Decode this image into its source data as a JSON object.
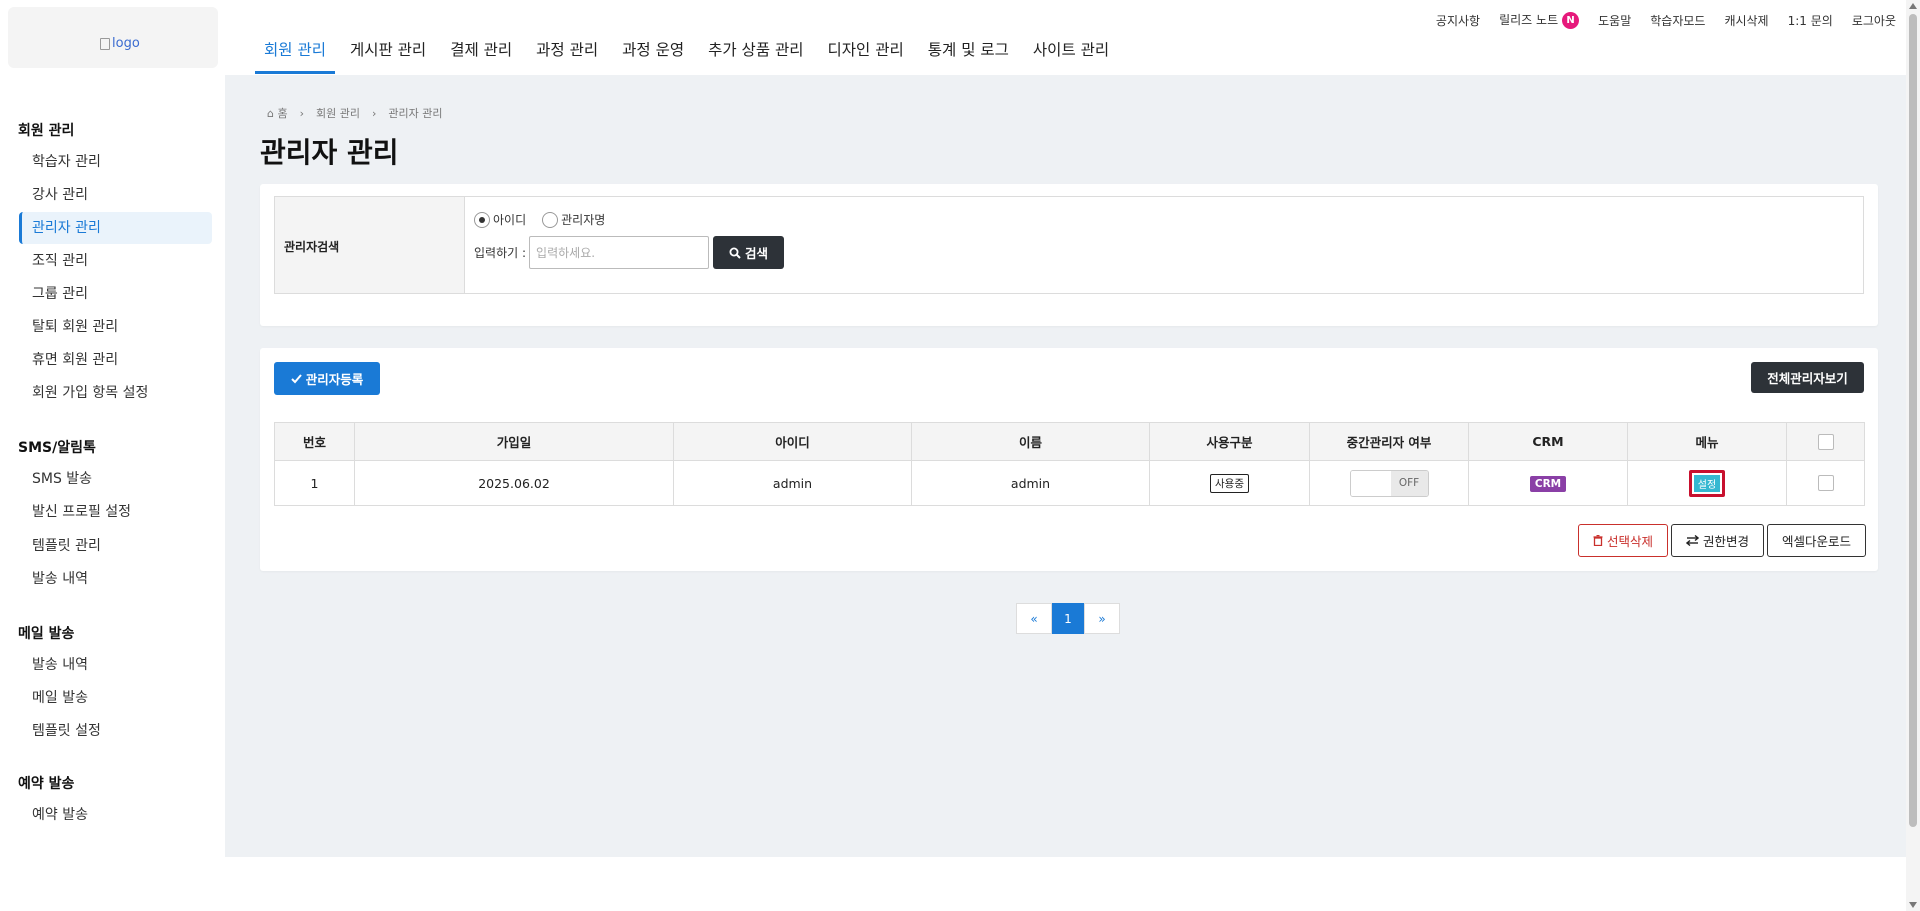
{
  "header": {
    "logo_alt": "logo",
    "gnb": [
      "회원 관리",
      "게시판 관리",
      "결제 관리",
      "과정 관리",
      "과정 운영",
      "추가 상품 관리",
      "디자인 관리",
      "통계 및 로그",
      "사이트 관리"
    ],
    "util": {
      "notice": "공지사항",
      "release_notes": "릴리즈 노트",
      "release_badge": "N",
      "help": "도움말",
      "learner_mode": "학습자모드",
      "cache_delete": "캐시삭제",
      "inquiry": "1:1 문의",
      "logout": "로그아웃"
    }
  },
  "sidebar": {
    "groups": [
      {
        "title": "회원 관리",
        "items": [
          "학습자 관리",
          "강사 관리",
          "관리자 관리",
          "조직 관리",
          "그룹 관리",
          "탈퇴 회원 관리",
          "휴면 회원 관리",
          "회원 가입 항목 설정"
        ]
      },
      {
        "title": "SMS/알림톡",
        "items": [
          "SMS 발송",
          "발신 프로필 설정",
          "템플릿 관리",
          "발송 내역"
        ]
      },
      {
        "title": "메일 발송",
        "items": [
          "발송 내역",
          "메일 발송",
          "템플릿 설정"
        ]
      },
      {
        "title": "예약 발송",
        "items": [
          "예약 발송"
        ]
      }
    ]
  },
  "breadcrumb": {
    "home": "홈",
    "level1": "회원 관리",
    "level2": "관리자 관리"
  },
  "page_title": "관리자 관리",
  "search": {
    "label": "관리자검색",
    "radio_id": "아이디",
    "radio_name": "관리자명",
    "input_label": "입력하기 :",
    "placeholder": "입력하세요.",
    "button": "검색"
  },
  "list": {
    "register_button": "관리자등록",
    "view_all_button": "전체관리자보기",
    "columns": [
      "번호",
      "가입일",
      "아이디",
      "이름",
      "사용구분",
      "중간관리자 여부",
      "CRM",
      "메뉴"
    ],
    "rows": [
      {
        "no": "1",
        "joined": "2025.06.02",
        "id": "admin",
        "name": "admin",
        "status": "사용중",
        "toggle": "OFF",
        "crm": "CRM",
        "menu": "설정"
      }
    ],
    "delete_button": "선택삭제",
    "permission_button": "권한변경",
    "excel_button": "엑셀다운로드"
  },
  "pager": {
    "prev": "«",
    "current": "1",
    "next": "»"
  },
  "colors": {
    "primary": "#1a7ad6",
    "dark": "#2d3238",
    "crm": "#8a3fa6",
    "setting": "#35b8d1",
    "highlight": "#c8102e",
    "badge": "#e6197b"
  }
}
